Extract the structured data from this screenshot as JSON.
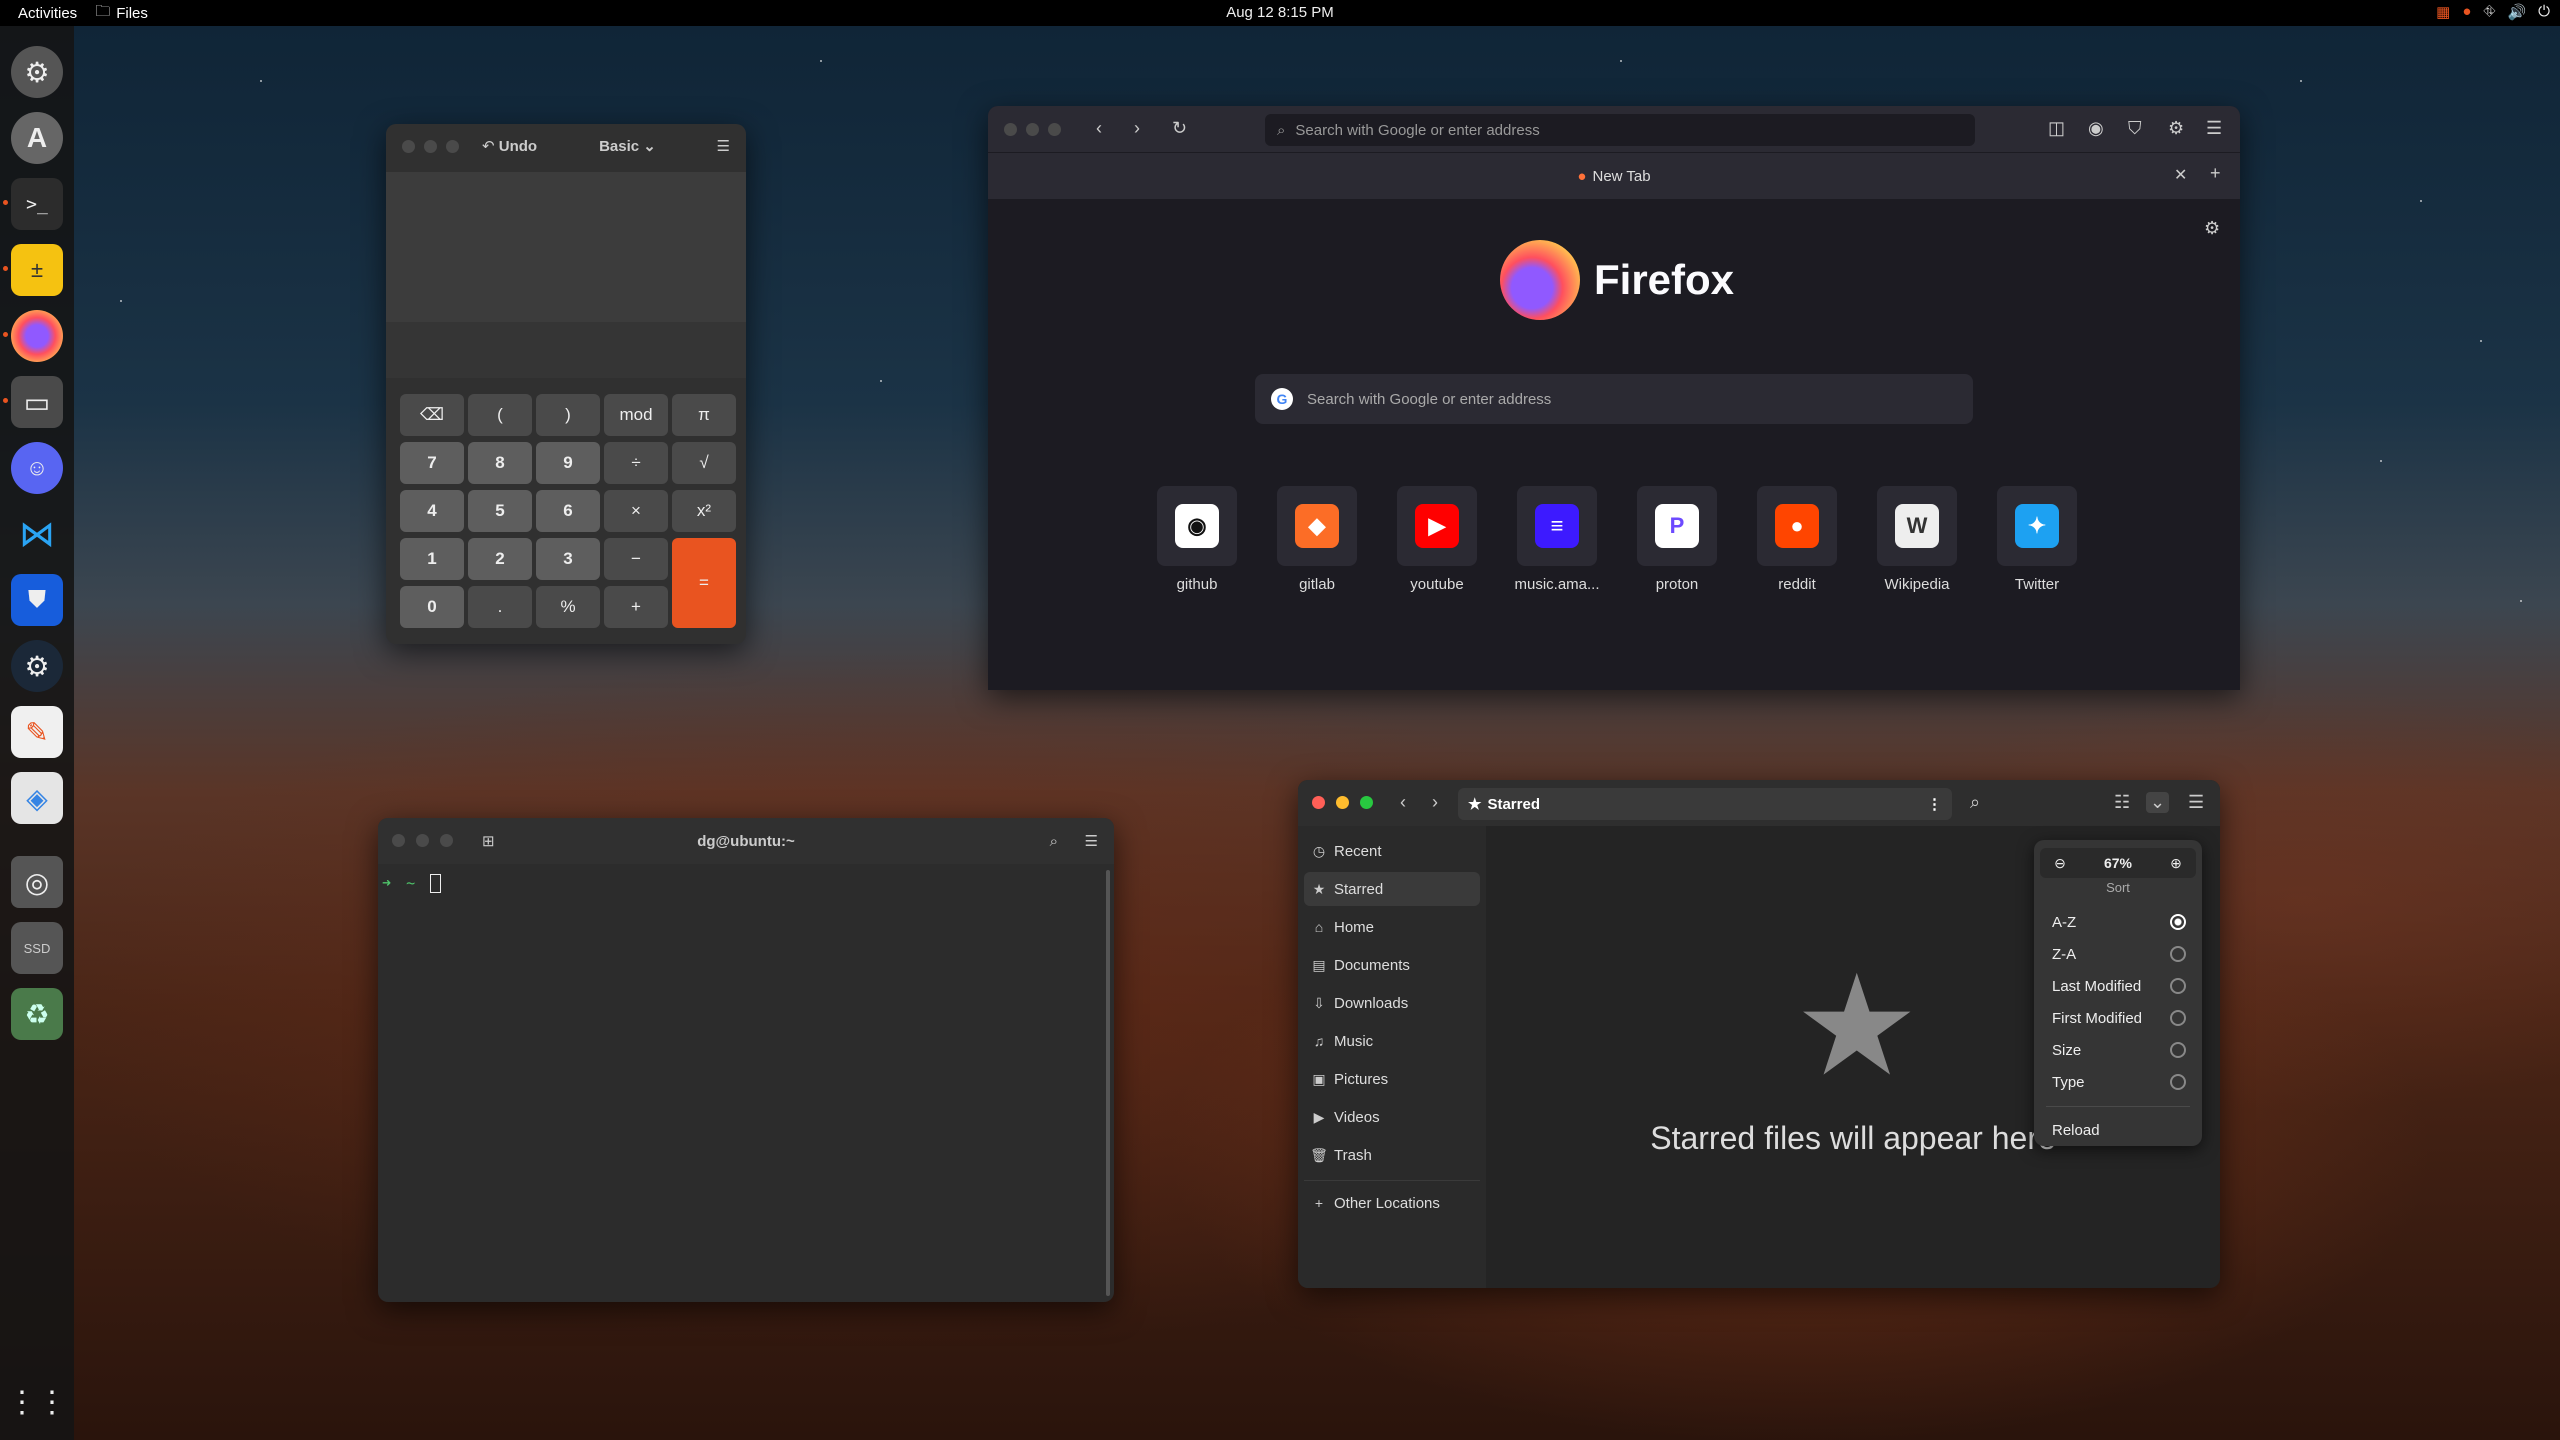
{
  "topbar": {
    "activities": "Activities",
    "app_name": "Files",
    "datetime": "Aug 12  8:15 PM"
  },
  "dock": {
    "apps": [
      "settings",
      "software",
      "terminal",
      "calculator",
      "firefox",
      "files",
      "discord",
      "vscode",
      "bitwarden",
      "steam",
      "text-editor",
      "flatseal",
      "disk",
      "ssd",
      "trash",
      "show-apps"
    ],
    "ssd_label": "SSD"
  },
  "calculator": {
    "undo_label": "Undo",
    "mode_label": "Basic",
    "buttons": [
      [
        "⌫",
        "(",
        ")",
        "mod",
        "π"
      ],
      [
        "7",
        "8",
        "9",
        "÷",
        "√"
      ],
      [
        "4",
        "5",
        "6",
        "×",
        "x²"
      ],
      [
        "1",
        "2",
        "3",
        "−",
        "="
      ],
      [
        "0",
        ".",
        "%",
        "+"
      ]
    ]
  },
  "firefox": {
    "url_placeholder": "Search with Google or enter address",
    "tab_title": "New Tab",
    "brand": "Firefox",
    "search_placeholder": "Search with Google or enter address",
    "tiles": [
      {
        "label": "github",
        "color": "#ffffff",
        "glyph": "◉",
        "fg": "#111"
      },
      {
        "label": "gitlab",
        "color": "#fc6d26",
        "glyph": "◆",
        "fg": "#fff"
      },
      {
        "label": "youtube",
        "color": "#ff0000",
        "glyph": "▶",
        "fg": "#fff"
      },
      {
        "label": "music.ama...",
        "color": "#3d1aff",
        "glyph": "≡",
        "fg": "#fff"
      },
      {
        "label": "proton",
        "color": "#ffffff",
        "glyph": "P",
        "fg": "#6d4aff"
      },
      {
        "label": "reddit",
        "color": "#ff4500",
        "glyph": "●",
        "fg": "#fff"
      },
      {
        "label": "Wikipedia",
        "color": "#eeeeee",
        "glyph": "W",
        "fg": "#333"
      },
      {
        "label": "Twitter",
        "color": "#1da1f2",
        "glyph": "✦",
        "fg": "#fff"
      }
    ]
  },
  "terminal": {
    "title": "dg@ubuntu:~",
    "prompt_arrow": "➜",
    "prompt_dir": "~"
  },
  "files": {
    "path_label": "Starred",
    "sidebar": [
      "Recent",
      "Starred",
      "Home",
      "Documents",
      "Downloads",
      "Music",
      "Pictures",
      "Videos",
      "Trash",
      "Other Locations"
    ],
    "empty_text": "Starred files will appear here",
    "zoom": "67%",
    "sort_heading": "Sort",
    "sort_options": [
      "A-Z",
      "Z-A",
      "Last Modified",
      "First Modified",
      "Size",
      "Type"
    ],
    "selected_sort": "A-Z",
    "reload_label": "Reload"
  }
}
